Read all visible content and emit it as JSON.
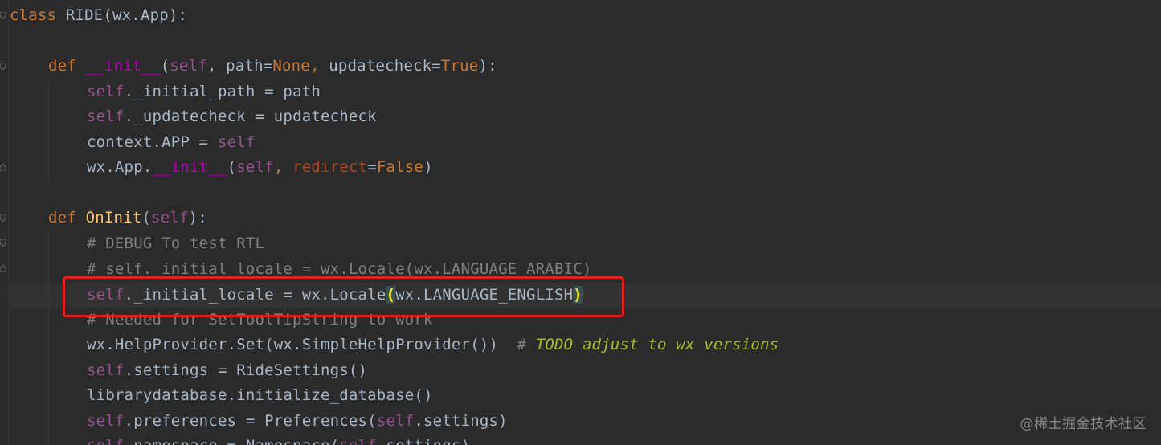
{
  "code": {
    "l1": {
      "a": "class ",
      "b": "RIDE(wx.App):"
    },
    "l3": {
      "a": "def ",
      "b": "__init__",
      "c": "(",
      "d": "self",
      "e": ", path=",
      "f": "None",
      "g": ", ",
      "h": "updatecheck=",
      "i": "True",
      "j": "):"
    },
    "l4": {
      "a": "self",
      "b": "._initial_path = path"
    },
    "l5": {
      "a": "self",
      "b": "._updatecheck = updatecheck"
    },
    "l6": {
      "a": "context.APP = ",
      "b": "self"
    },
    "l7": {
      "a": "wx.App.",
      "b": "__init__",
      "c": "(",
      "d": "self",
      "e": ", ",
      "f": "redirect",
      "g": "=",
      "h": "False",
      "i": ")"
    },
    "l9": {
      "a": "def ",
      "b": "OnInit",
      "c": "(",
      "d": "self",
      "e": "):"
    },
    "l10": {
      "a": "# DEBUG To test RTL"
    },
    "l11": {
      "a": "# self._initial_locale = wx.Locale(wx.LANGUAGE_ARABIC)"
    },
    "l12": {
      "a": "self",
      "b": "._initial_locale = wx.Locale",
      "c": "(",
      "d": "wx.LANGUAGE_ENGLISH",
      "e": ")"
    },
    "l13": {
      "a": "# Needed for SetToolTipString to work"
    },
    "l14": {
      "a": "wx.HelpProvider.Set(wx.SimpleHelpProvider())  ",
      "b": "# ",
      "c": "TODO adjust to wx versions"
    },
    "l15": {
      "a": "self",
      "b": ".settings = RideSettings()"
    },
    "l16": {
      "a": "librarydatabase.initialize_database()"
    },
    "l17": {
      "a": "self",
      "b": ".preferences = Preferences(",
      "c": "self",
      "d": ".settings)"
    },
    "l18": {
      "a": "self",
      "b": ".namespace = Namespace(",
      "c": "self",
      "d": ".settings)"
    }
  },
  "watermark": "@稀土掘金技术社区",
  "colors": {
    "background": "#2b2b2b",
    "keyword": "#cc7832",
    "self": "#94558d",
    "magic": "#b200b2",
    "function": "#ffc66d",
    "comment": "#808080",
    "todo": "#a8c023",
    "highlight_box": "#e02020"
  }
}
